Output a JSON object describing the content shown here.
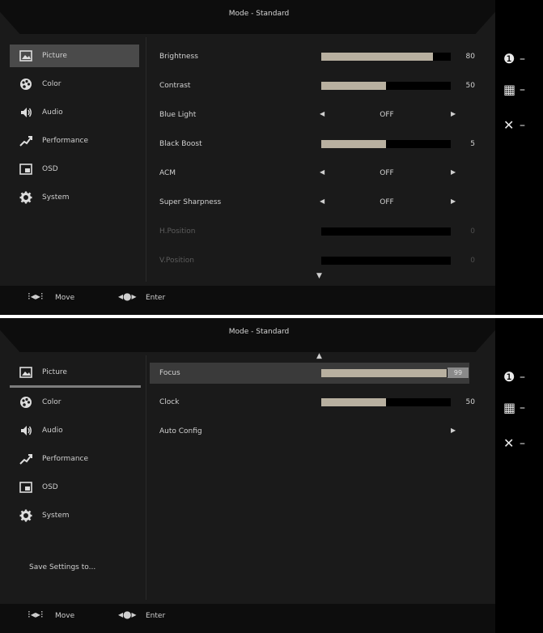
{
  "title": "Mode - Standard",
  "sidebar": [
    {
      "label": "Picture",
      "icon": "picture-icon"
    },
    {
      "label": "Color",
      "icon": "color-icon"
    },
    {
      "label": "Audio",
      "icon": "audio-icon"
    },
    {
      "label": "Performance",
      "icon": "performance-icon"
    },
    {
      "label": "OSD",
      "icon": "osd-icon"
    },
    {
      "label": "System",
      "icon": "system-icon"
    }
  ],
  "panel1": {
    "brightness": {
      "label": "Brightness",
      "value": "80",
      "level": 0.86
    },
    "contrast": {
      "label": "Contrast",
      "value": "50",
      "level": 0.5
    },
    "blue_light": {
      "label": "Blue Light",
      "value": "OFF"
    },
    "black_boost": {
      "label": "Black Boost",
      "value": "5",
      "level": 0.5
    },
    "acm": {
      "label": "ACM",
      "value": "OFF"
    },
    "super_sharpness": {
      "label": "Super Sharpness",
      "value": "OFF"
    },
    "h_position": {
      "label": "H.Position",
      "value": "0"
    },
    "v_position": {
      "label": "V.Position",
      "value": "0"
    }
  },
  "panel2": {
    "focus": {
      "label": "Focus",
      "value": "99",
      "level": 0.97
    },
    "clock": {
      "label": "Clock",
      "value": "50",
      "level": 0.5
    },
    "auto_config": {
      "label": "Auto Config"
    },
    "save_settings": "Save Settings to..."
  },
  "footer": {
    "move": "Move",
    "enter": "Enter"
  },
  "right_icons": [
    "info-icon",
    "grid-icon",
    "close-icon"
  ]
}
